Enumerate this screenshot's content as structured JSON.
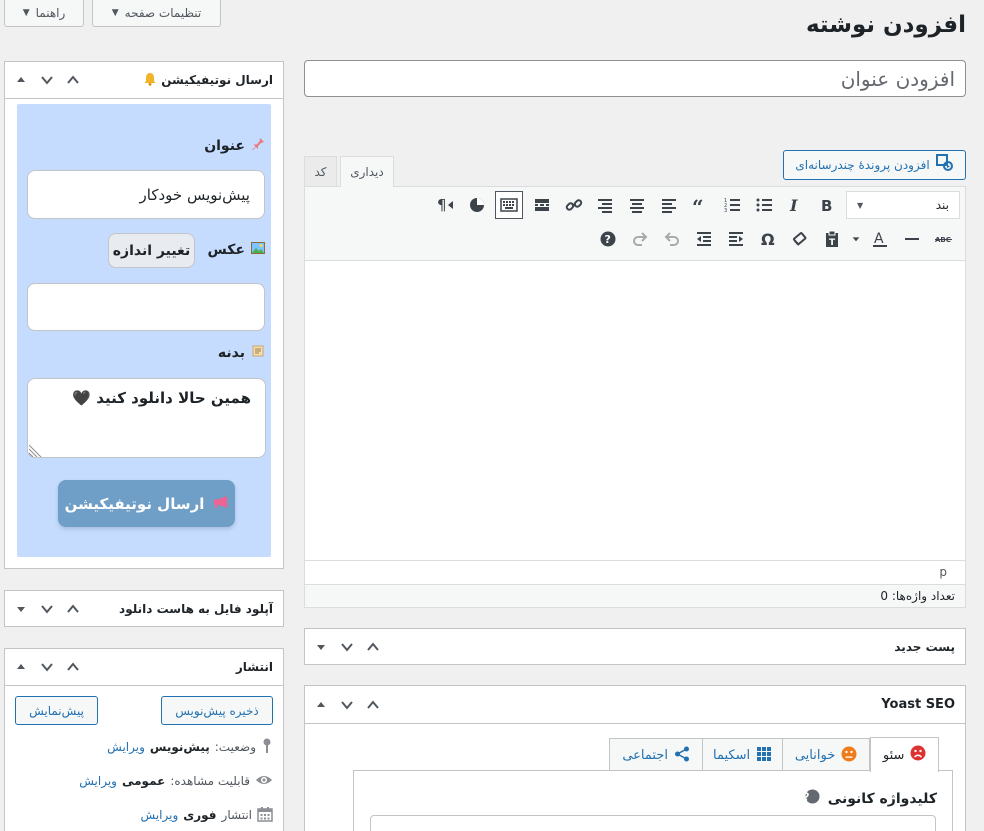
{
  "screen": {
    "help_button": "راهنما",
    "screen_options_button": "تنظیمات صفحه",
    "page_title": "افزودن نوشته"
  },
  "title_input": {
    "placeholder": "افزودن عنوان"
  },
  "editor": {
    "add_media_button": "افزودن پروندهٔ چندرسانه‌ای",
    "tab_visual": "دیداری",
    "tab_code": "کد",
    "format_select": "بند",
    "path_label": "p",
    "word_count": "تعداد واژه‌ها: 0"
  },
  "notification_box": {
    "title": "ارسال نوتیفیکیشن",
    "title_label": "عنوان",
    "title_value": "پیش‌نویس خودکار",
    "image_label": "عکس",
    "resize_button": "تغییر اندازه",
    "body_label": "بدنه",
    "body_value": "همین حالا دانلود کنید 🖤",
    "send_button": "ارسال نوتیفیکیشن"
  },
  "upload_box": {
    "title": "آپلود فایل به هاست دانلود"
  },
  "publish_box": {
    "title": "انتشار",
    "save_draft_button": "ذخیره پیش‌نویس",
    "preview_button": "پیش‌نمایش",
    "status_label": "وضعیت:",
    "status_value": "پیش‌نویس",
    "status_edit": "ویرایش",
    "visibility_label": "قابلیت مشاهده:",
    "visibility_value": "عمومی",
    "visibility_edit": "ویرایش",
    "publish_label": "انتشار",
    "publish_value": "فوری",
    "publish_edit": "ویرایش"
  },
  "new_post_box": {
    "title": "پست جدید"
  },
  "yoast_box": {
    "title": "Yoast SEO",
    "tabs": [
      "سئو",
      "خوانایی",
      "اسکیما",
      "اجتماعی"
    ],
    "focus_keyword_label": "کلیدواژه کانونی"
  },
  "colors": {
    "accent": "#2271b1",
    "notification_panel": "#c5dcff",
    "send_button": "#6f9ec7",
    "page_bg": "#f0f0f1"
  }
}
